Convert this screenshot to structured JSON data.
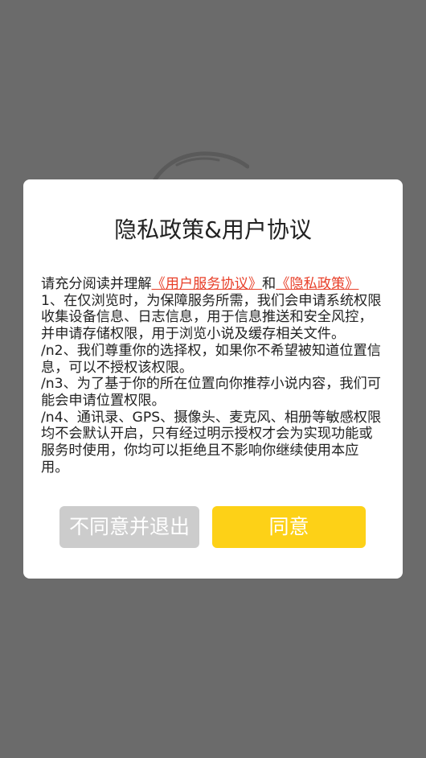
{
  "dialog": {
    "title": "隐私政策&用户协议",
    "intro": "请充分阅读并理解",
    "link_service": "《用户服务协议》",
    "and": "和",
    "link_privacy": "《隐私政策》",
    "item1": "1、在仅浏览时，为保障服务所需，我们会申请系统权限收集设备信息、日志信息，用于信息推送和安全风控，并申请存储权限，用于浏览小说及缓存相关文件。",
    "item2": "/n2、我们尊重你的选择权，如果你不希望被知道位置信息，可以不授权该权限。",
    "item3": "/n3、为了基于你的所在位置向你推荐小说内容，我们可能会申请位置权限。",
    "item4": "/n4、通讯录、GPS、摄像头、麦克风、相册等敏感权限均不会默认开启，只有经过明示授权才会为实现功能或服务时使用，你均可以拒绝且不影响你继续使用本应用。",
    "disagree_label": "不同意并退出",
    "agree_label": "同意"
  },
  "colors": {
    "overlay": "#6b6b6b",
    "link": "#e8402a",
    "agree_button": "#fdd117",
    "disagree_button": "#cccccc"
  }
}
